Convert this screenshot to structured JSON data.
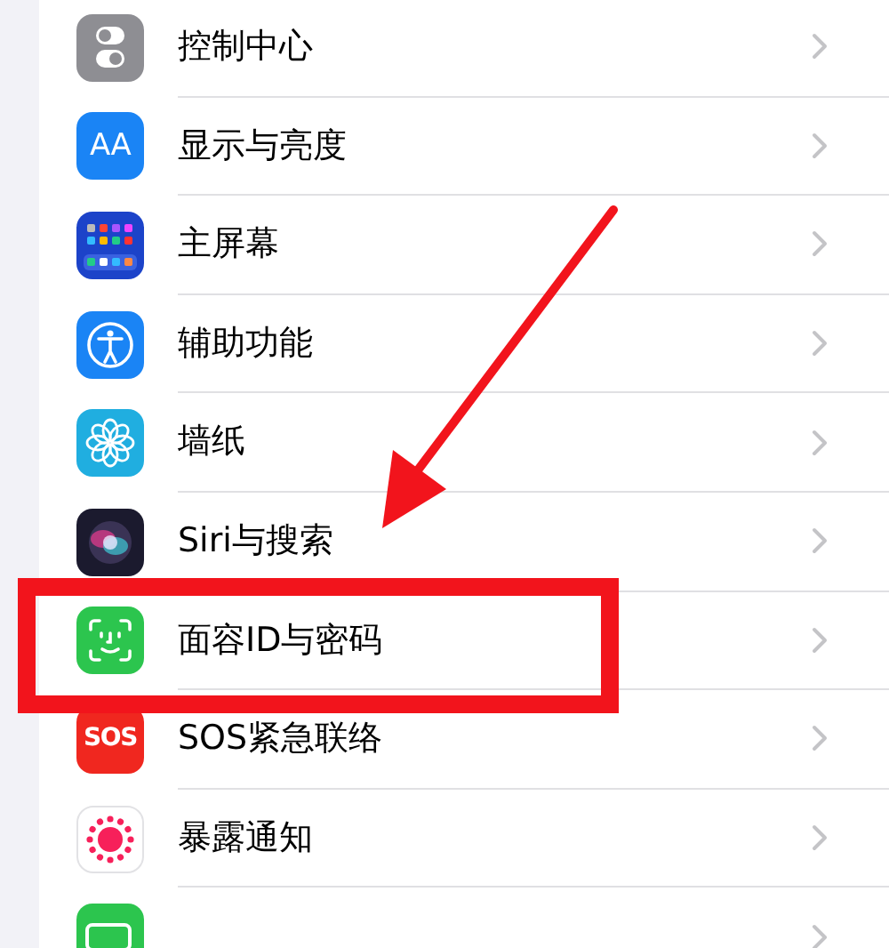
{
  "rows": [
    {
      "label": "控制中心"
    },
    {
      "label": "显示与亮度",
      "icon_text": "AA"
    },
    {
      "label": "主屏幕"
    },
    {
      "label": "辅助功能"
    },
    {
      "label": "墙纸"
    },
    {
      "label": "Siri与搜索"
    },
    {
      "label": "面容ID与密码"
    },
    {
      "label": "SOS紧急联络",
      "icon_text": "SOS"
    },
    {
      "label": "暴露通知"
    },
    {}
  ]
}
